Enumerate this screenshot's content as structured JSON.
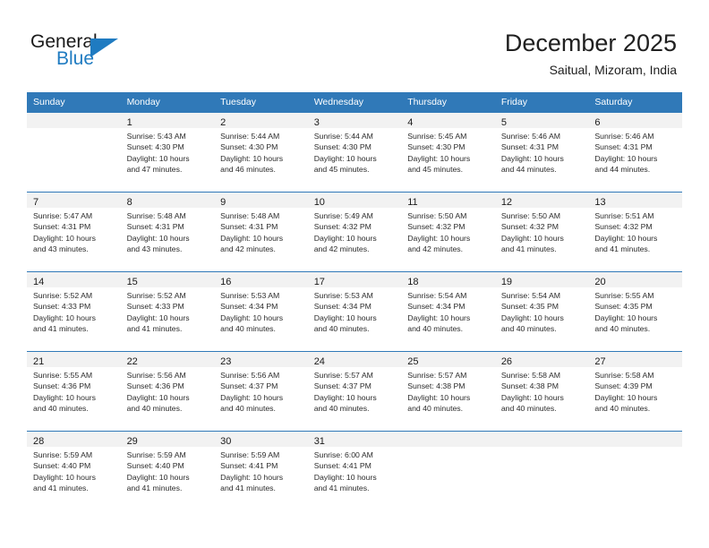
{
  "brand": {
    "name_part1": "General",
    "name_part2": "Blue",
    "accent_color": "#1f7bc1",
    "flag_icon": "triangle-flag-icon"
  },
  "header": {
    "title": "December 2025",
    "subtitle": "Saitual, Mizoram, India"
  },
  "theme": {
    "header_bg": "#3079b8",
    "daynum_band_bg": "#f2f2f2",
    "grid_line": "#3079b8",
    "text": "#2b2b2b"
  },
  "columns": [
    "Sunday",
    "Monday",
    "Tuesday",
    "Wednesday",
    "Thursday",
    "Friday",
    "Saturday"
  ],
  "labels": {
    "sunrise_prefix": "Sunrise:",
    "sunset_prefix": "Sunset:",
    "daylight_prefix": "Daylight:"
  },
  "weeks": [
    [
      {
        "day": "",
        "line1": "",
        "line2": "",
        "line3": "",
        "line4": ""
      },
      {
        "day": "1",
        "line1": "Sunrise: 5:43 AM",
        "line2": "Sunset: 4:30 PM",
        "line3": "Daylight: 10 hours",
        "line4": "and 47 minutes."
      },
      {
        "day": "2",
        "line1": "Sunrise: 5:44 AM",
        "line2": "Sunset: 4:30 PM",
        "line3": "Daylight: 10 hours",
        "line4": "and 46 minutes."
      },
      {
        "day": "3",
        "line1": "Sunrise: 5:44 AM",
        "line2": "Sunset: 4:30 PM",
        "line3": "Daylight: 10 hours",
        "line4": "and 45 minutes."
      },
      {
        "day": "4",
        "line1": "Sunrise: 5:45 AM",
        "line2": "Sunset: 4:30 PM",
        "line3": "Daylight: 10 hours",
        "line4": "and 45 minutes."
      },
      {
        "day": "5",
        "line1": "Sunrise: 5:46 AM",
        "line2": "Sunset: 4:31 PM",
        "line3": "Daylight: 10 hours",
        "line4": "and 44 minutes."
      },
      {
        "day": "6",
        "line1": "Sunrise: 5:46 AM",
        "line2": "Sunset: 4:31 PM",
        "line3": "Daylight: 10 hours",
        "line4": "and 44 minutes."
      }
    ],
    [
      {
        "day": "7",
        "line1": "Sunrise: 5:47 AM",
        "line2": "Sunset: 4:31 PM",
        "line3": "Daylight: 10 hours",
        "line4": "and 43 minutes."
      },
      {
        "day": "8",
        "line1": "Sunrise: 5:48 AM",
        "line2": "Sunset: 4:31 PM",
        "line3": "Daylight: 10 hours",
        "line4": "and 43 minutes."
      },
      {
        "day": "9",
        "line1": "Sunrise: 5:48 AM",
        "line2": "Sunset: 4:31 PM",
        "line3": "Daylight: 10 hours",
        "line4": "and 42 minutes."
      },
      {
        "day": "10",
        "line1": "Sunrise: 5:49 AM",
        "line2": "Sunset: 4:32 PM",
        "line3": "Daylight: 10 hours",
        "line4": "and 42 minutes."
      },
      {
        "day": "11",
        "line1": "Sunrise: 5:50 AM",
        "line2": "Sunset: 4:32 PM",
        "line3": "Daylight: 10 hours",
        "line4": "and 42 minutes."
      },
      {
        "day": "12",
        "line1": "Sunrise: 5:50 AM",
        "line2": "Sunset: 4:32 PM",
        "line3": "Daylight: 10 hours",
        "line4": "and 41 minutes."
      },
      {
        "day": "13",
        "line1": "Sunrise: 5:51 AM",
        "line2": "Sunset: 4:32 PM",
        "line3": "Daylight: 10 hours",
        "line4": "and 41 minutes."
      }
    ],
    [
      {
        "day": "14",
        "line1": "Sunrise: 5:52 AM",
        "line2": "Sunset: 4:33 PM",
        "line3": "Daylight: 10 hours",
        "line4": "and 41 minutes."
      },
      {
        "day": "15",
        "line1": "Sunrise: 5:52 AM",
        "line2": "Sunset: 4:33 PM",
        "line3": "Daylight: 10 hours",
        "line4": "and 41 minutes."
      },
      {
        "day": "16",
        "line1": "Sunrise: 5:53 AM",
        "line2": "Sunset: 4:34 PM",
        "line3": "Daylight: 10 hours",
        "line4": "and 40 minutes."
      },
      {
        "day": "17",
        "line1": "Sunrise: 5:53 AM",
        "line2": "Sunset: 4:34 PM",
        "line3": "Daylight: 10 hours",
        "line4": "and 40 minutes."
      },
      {
        "day": "18",
        "line1": "Sunrise: 5:54 AM",
        "line2": "Sunset: 4:34 PM",
        "line3": "Daylight: 10 hours",
        "line4": "and 40 minutes."
      },
      {
        "day": "19",
        "line1": "Sunrise: 5:54 AM",
        "line2": "Sunset: 4:35 PM",
        "line3": "Daylight: 10 hours",
        "line4": "and 40 minutes."
      },
      {
        "day": "20",
        "line1": "Sunrise: 5:55 AM",
        "line2": "Sunset: 4:35 PM",
        "line3": "Daylight: 10 hours",
        "line4": "and 40 minutes."
      }
    ],
    [
      {
        "day": "21",
        "line1": "Sunrise: 5:55 AM",
        "line2": "Sunset: 4:36 PM",
        "line3": "Daylight: 10 hours",
        "line4": "and 40 minutes."
      },
      {
        "day": "22",
        "line1": "Sunrise: 5:56 AM",
        "line2": "Sunset: 4:36 PM",
        "line3": "Daylight: 10 hours",
        "line4": "and 40 minutes."
      },
      {
        "day": "23",
        "line1": "Sunrise: 5:56 AM",
        "line2": "Sunset: 4:37 PM",
        "line3": "Daylight: 10 hours",
        "line4": "and 40 minutes."
      },
      {
        "day": "24",
        "line1": "Sunrise: 5:57 AM",
        "line2": "Sunset: 4:37 PM",
        "line3": "Daylight: 10 hours",
        "line4": "and 40 minutes."
      },
      {
        "day": "25",
        "line1": "Sunrise: 5:57 AM",
        "line2": "Sunset: 4:38 PM",
        "line3": "Daylight: 10 hours",
        "line4": "and 40 minutes."
      },
      {
        "day": "26",
        "line1": "Sunrise: 5:58 AM",
        "line2": "Sunset: 4:38 PM",
        "line3": "Daylight: 10 hours",
        "line4": "and 40 minutes."
      },
      {
        "day": "27",
        "line1": "Sunrise: 5:58 AM",
        "line2": "Sunset: 4:39 PM",
        "line3": "Daylight: 10 hours",
        "line4": "and 40 minutes."
      }
    ],
    [
      {
        "day": "28",
        "line1": "Sunrise: 5:59 AM",
        "line2": "Sunset: 4:40 PM",
        "line3": "Daylight: 10 hours",
        "line4": "and 41 minutes."
      },
      {
        "day": "29",
        "line1": "Sunrise: 5:59 AM",
        "line2": "Sunset: 4:40 PM",
        "line3": "Daylight: 10 hours",
        "line4": "and 41 minutes."
      },
      {
        "day": "30",
        "line1": "Sunrise: 5:59 AM",
        "line2": "Sunset: 4:41 PM",
        "line3": "Daylight: 10 hours",
        "line4": "and 41 minutes."
      },
      {
        "day": "31",
        "line1": "Sunrise: 6:00 AM",
        "line2": "Sunset: 4:41 PM",
        "line3": "Daylight: 10 hours",
        "line4": "and 41 minutes."
      },
      {
        "day": "",
        "line1": "",
        "line2": "",
        "line3": "",
        "line4": ""
      },
      {
        "day": "",
        "line1": "",
        "line2": "",
        "line3": "",
        "line4": ""
      },
      {
        "day": "",
        "line1": "",
        "line2": "",
        "line3": "",
        "line4": ""
      }
    ]
  ]
}
